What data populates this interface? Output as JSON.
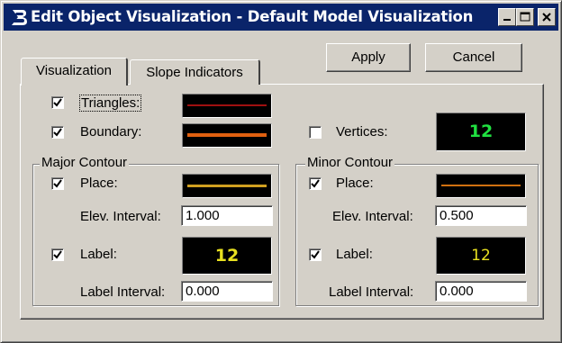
{
  "window": {
    "title": "Edit Object Visualization - Default Model Visualization",
    "icon": "bentley-b-icon",
    "buttons": [
      "minimize-icon",
      "maximize-icon",
      "close-icon"
    ]
  },
  "tabs": [
    {
      "label": "Visualization",
      "active": true
    },
    {
      "label": "Slope Indicators",
      "active": false
    }
  ],
  "actions": {
    "apply": "Apply",
    "cancel": "Cancel"
  },
  "visualization": {
    "triangles": {
      "label": "Triangles:",
      "checked": true,
      "color": "#a01010"
    },
    "boundary": {
      "label": "Boundary:",
      "checked": true,
      "color": "#e06010"
    },
    "vertices": {
      "label": "Vertices:",
      "checked": false,
      "sample": "12",
      "color": "#20e040"
    },
    "major": {
      "title": "Major Contour",
      "place": {
        "label": "Place:",
        "checked": true,
        "color": "#d0a020"
      },
      "elev_interval": {
        "label": "Elev. Interval:",
        "value": "1.000"
      },
      "label": {
        "label": "Label:",
        "checked": true,
        "sample": "12",
        "color": "#e8e020"
      },
      "label_interval": {
        "label": "Label Interval:",
        "value": "0.000"
      }
    },
    "minor": {
      "title": "Minor Contour",
      "place": {
        "label": "Place:",
        "checked": true,
        "color": "#d07010"
      },
      "elev_interval": {
        "label": "Elev. Interval:",
        "value": "0.500"
      },
      "label": {
        "label": "Label:",
        "checked": true,
        "sample": "12",
        "color": "#e8e020"
      },
      "label_interval": {
        "label": "Label Interval:",
        "value": "0.000"
      }
    }
  },
  "colors": {
    "titlebar": "#0a246a",
    "face": "#d4d0c8",
    "swatch_bg": "#000000"
  }
}
